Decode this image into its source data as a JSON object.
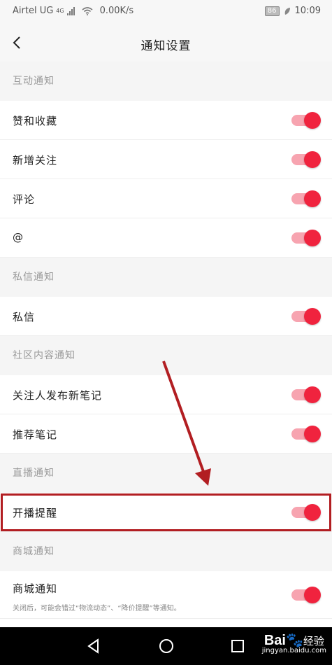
{
  "status_bar": {
    "carrier": "Airtel UG",
    "network": "4G",
    "speed": "0.00K/s",
    "battery": "86",
    "time": "10:09"
  },
  "header": {
    "title": "通知设置",
    "back_icon": "chevron-left-icon"
  },
  "sections": {
    "interaction": {
      "header": "互动通知",
      "items": [
        {
          "label": "赞和收藏",
          "enabled": true
        },
        {
          "label": "新增关注",
          "enabled": true
        },
        {
          "label": "评论",
          "enabled": true
        },
        {
          "label": "@",
          "enabled": true
        }
      ]
    },
    "private_message": {
      "header": "私信通知",
      "items": [
        {
          "label": "私信",
          "enabled": true
        }
      ]
    },
    "community": {
      "header": "社区内容通知",
      "items": [
        {
          "label": "关注人发布新笔记",
          "enabled": true
        },
        {
          "label": "推荐笔记",
          "enabled": true
        }
      ]
    },
    "live": {
      "header": "直播通知",
      "items": [
        {
          "label": "开播提醒",
          "enabled": true
        }
      ]
    },
    "mall": {
      "header": "商城通知",
      "items": [
        {
          "label": "商城通知",
          "enabled": true,
          "note": "关闭后，可能会错过“物流动态”、“降价提醒”等通知。"
        }
      ]
    }
  },
  "colors": {
    "toggle_on_knob": "#f0233e",
    "toggle_on_track": "#f7a4b0",
    "annotation": "#b21e22"
  },
  "watermark": {
    "brand": "Bai",
    "brand_suffix": "经验",
    "url": "jingyan.baidu.com"
  }
}
